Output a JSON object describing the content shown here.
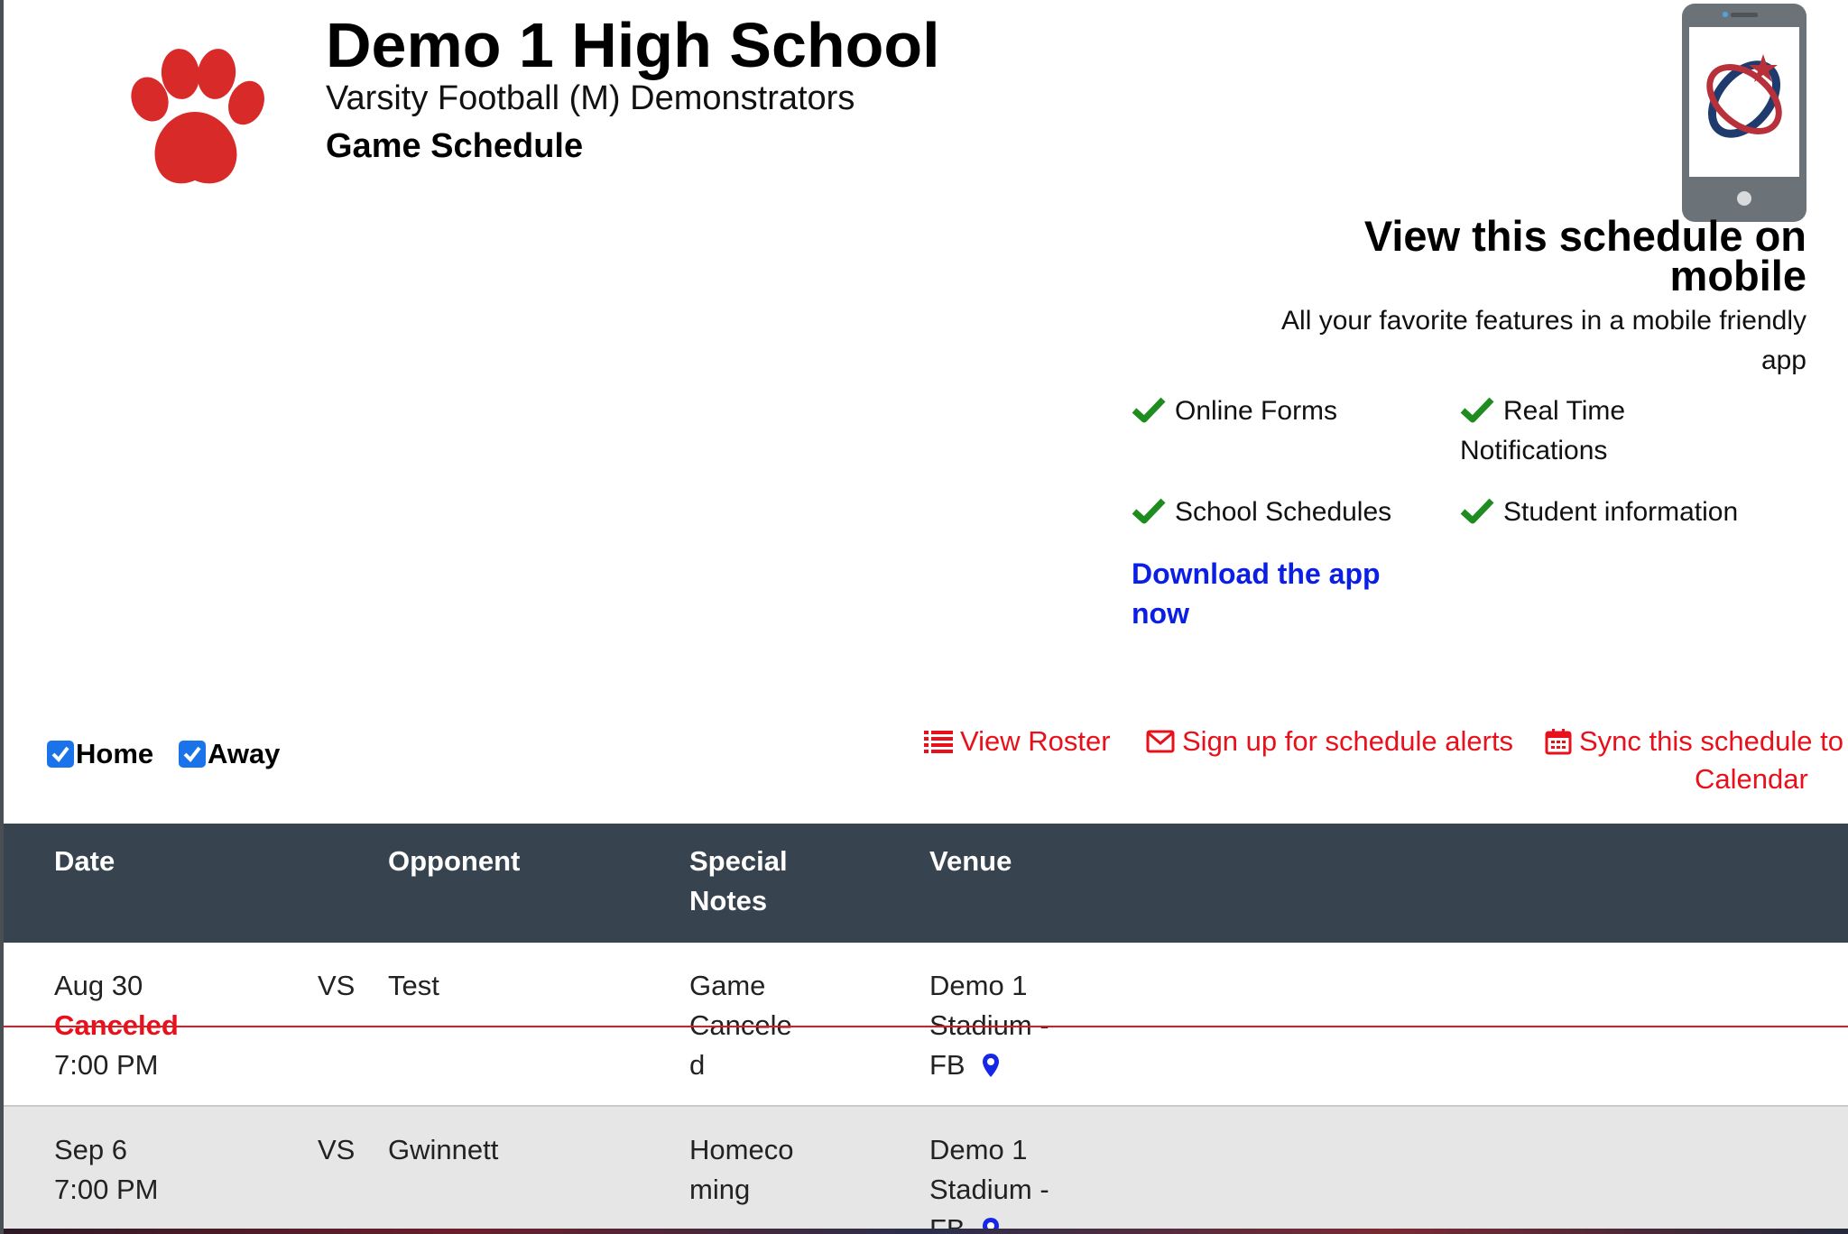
{
  "header": {
    "school_name": "Demo 1 High School",
    "team_name": "Varsity Football (M) Demonstrators",
    "schedule_label": "Game Schedule"
  },
  "promo": {
    "title": "View this schedule on mobile",
    "subtitle": "All your favorite features in a mobile friendly app",
    "features": [
      "Online Forms",
      "Real Time Notifications",
      "School Schedules",
      "Student information"
    ],
    "download_label": "Download the app now"
  },
  "filters": {
    "home_label": "Home",
    "away_label": "Away",
    "home_checked": true,
    "away_checked": true
  },
  "actions": {
    "view_roster": "View Roster",
    "sign_up_alerts": "Sign up for schedule alerts",
    "sync_line1": "Sync this schedule to",
    "sync_line2": "Calendar"
  },
  "table": {
    "headers": {
      "date": "Date",
      "opponent": "Opponent",
      "special_notes_line1": "Special",
      "special_notes_line2": "Notes",
      "venue": "Venue"
    },
    "rows": [
      {
        "date": "Aug 30",
        "status": "Canceled",
        "time": "7:00 PM",
        "vs": "VS",
        "opponent": "Test",
        "notes_lines": [
          "Game",
          "Cancele",
          "d"
        ],
        "venue_lines": [
          "Demo 1",
          "Stadium -",
          "FB"
        ]
      },
      {
        "date": "Sep 6",
        "time": "7:00 PM",
        "vs": "VS",
        "opponent": "Gwinnett",
        "notes_lines": [
          "Homeco",
          "ming"
        ],
        "venue_lines": [
          "Demo 1",
          "Stadium -",
          "FB"
        ]
      }
    ]
  },
  "colors": {
    "accent_red": "#e8101b",
    "link_blue": "#0a1ee6",
    "header_bg": "#37444f",
    "check_green": "#1e8c1e",
    "checkbox_blue": "#1a73e8"
  },
  "icons": {
    "paw": "paw-logo-icon",
    "phone": "phone-app-icon",
    "check": "check-icon",
    "list": "list-icon",
    "envelope": "envelope-icon",
    "calendar": "calendar-icon",
    "pin": "map-pin-icon"
  }
}
